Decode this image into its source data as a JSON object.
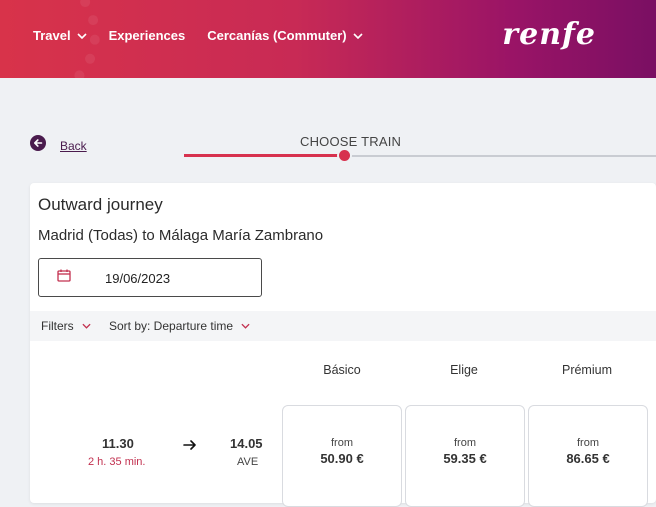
{
  "header": {
    "nav": [
      {
        "label": "Travel",
        "has_dropdown": true
      },
      {
        "label": "Experiences",
        "has_dropdown": false
      },
      {
        "label": "Cercanías (Commuter)",
        "has_dropdown": true
      }
    ],
    "logo_text": "renfe",
    "icons": {
      "dropdown": "chevron-down-icon"
    }
  },
  "back": {
    "label": "Back",
    "icon": "back-arrow-circle-icon"
  },
  "steps": {
    "current_label": "CHOOSE TRAIN",
    "progress_fraction": 0.34
  },
  "journey": {
    "title": "Outward journey",
    "route": "Madrid (Todas) to Málaga María Zambrano",
    "date": "19/06/2023",
    "date_icon": "calendar-icon"
  },
  "filters": {
    "filters_label": "Filters",
    "sort_label": "Sort by: Departure time"
  },
  "fares": {
    "headers": [
      "Básico",
      "Elige",
      "Prémium"
    ]
  },
  "trains": [
    {
      "departure": "11.30",
      "duration": "2 h. 35 min.",
      "arrival": "14.05",
      "type": "AVE",
      "prices": [
        {
          "from": "from",
          "price": "50.90 €"
        },
        {
          "from": "from",
          "price": "59.35 €"
        },
        {
          "from": "from",
          "price": "86.65 €"
        }
      ]
    }
  ],
  "colors": {
    "accent": "#d7314e",
    "header_start": "#d8334a",
    "header_end": "#7a0f63",
    "back_icon": "#4a1b4d"
  }
}
